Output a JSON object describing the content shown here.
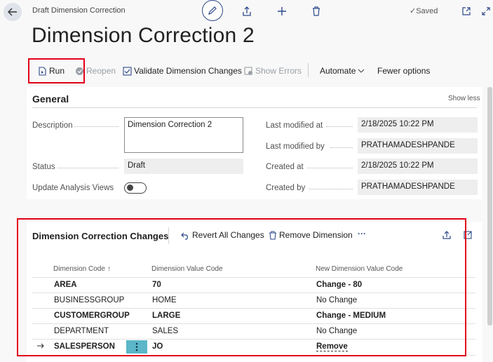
{
  "header": {
    "breadcrumb": "Draft Dimension Correction",
    "saved_label": "Saved",
    "title": "Dimension Correction 2"
  },
  "actions": {
    "run": "Run",
    "reopen": "Reopen",
    "validate": "Validate Dimension Changes",
    "show_errors": "Show Errors",
    "automate": "Automate",
    "fewer_options": "Fewer options"
  },
  "general": {
    "title": "General",
    "show_less": "Show less",
    "description_label": "Description",
    "description_value": "Dimension Correction 2",
    "status_label": "Status",
    "status_value": "Draft",
    "update_analysis_label": "Update Analysis Views",
    "last_modified_at_label": "Last modified at",
    "last_modified_at_value": "2/18/2025 10:22 PM",
    "last_modified_by_label": "Last modified by",
    "last_modified_by_value": "PRATHAMADESHPANDE",
    "created_at_label": "Created at",
    "created_at_value": "2/18/2025 10:22 PM",
    "created_by_label": "Created by",
    "created_by_value": "PRATHAMADESHPANDE"
  },
  "changes": {
    "title": "Dimension Correction Changes",
    "revert": "Revert All Changes",
    "remove": "Remove Dimension",
    "more": "···",
    "columns": [
      "Dimension Code ↑",
      "Dimension Value Code",
      "New Dimension Value Code"
    ],
    "rows": [
      {
        "code": "AREA",
        "value": "70",
        "new_value": "Change - 80",
        "bold": true
      },
      {
        "code": "BUSINESSGROUP",
        "value": "HOME",
        "new_value": "No Change",
        "bold": false
      },
      {
        "code": "CUSTOMERGROUP",
        "value": "LARGE",
        "new_value": "Change - MEDIUM",
        "bold": true
      },
      {
        "code": "DEPARTMENT",
        "value": "SALES",
        "new_value": "No Change",
        "bold": false
      },
      {
        "code": "SALESPERSON",
        "value": "JO",
        "new_value": "Remove",
        "bold": true
      }
    ]
  },
  "colors": {
    "highlight": "#e3001b",
    "accent": "#2d4a8a",
    "selected_cell": "#5ab6c8"
  }
}
